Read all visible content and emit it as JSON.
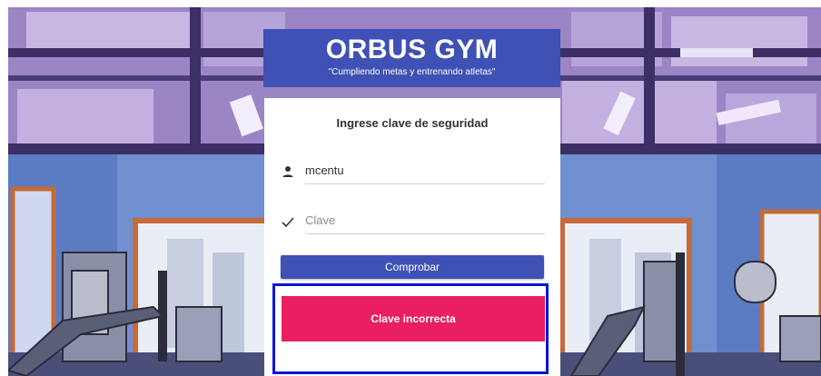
{
  "app": {
    "brand": "ORBUS GYM",
    "tagline": "\"Cumpliendo metas y entrenando atletas\""
  },
  "login": {
    "title": "Ingrese clave de seguridad",
    "username_value": "mcentu",
    "password_placeholder": "Clave",
    "submit_label": "Comprobar"
  },
  "alert": {
    "message": "Clave incorrecta"
  },
  "icons": {
    "username": "person-icon",
    "password": "check-icon"
  },
  "colors": {
    "primary": "#3f51b5",
    "error": "#e91e63",
    "highlight_outline": "#0a15d6"
  }
}
